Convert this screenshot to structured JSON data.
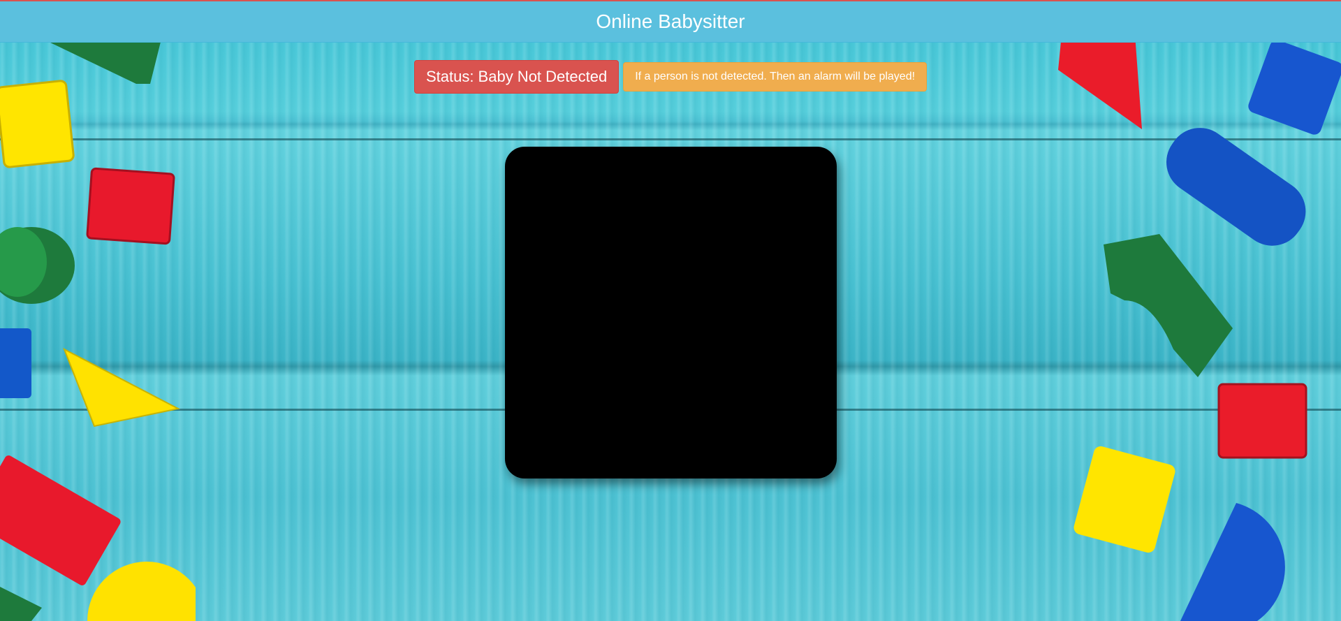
{
  "header": {
    "title": "Online Babysitter"
  },
  "status": {
    "label": "Status: Baby Not Detected",
    "alarm_note": "If a person is not detected. Then an alarm will be played!"
  },
  "colors": {
    "header_bg": "#5bc0de",
    "status_danger": "#d9534f",
    "alarm_warning": "#f0ad4e",
    "video_bg": "#000000"
  },
  "decorations": {
    "background": "wood-planks-with-toy-blocks"
  }
}
